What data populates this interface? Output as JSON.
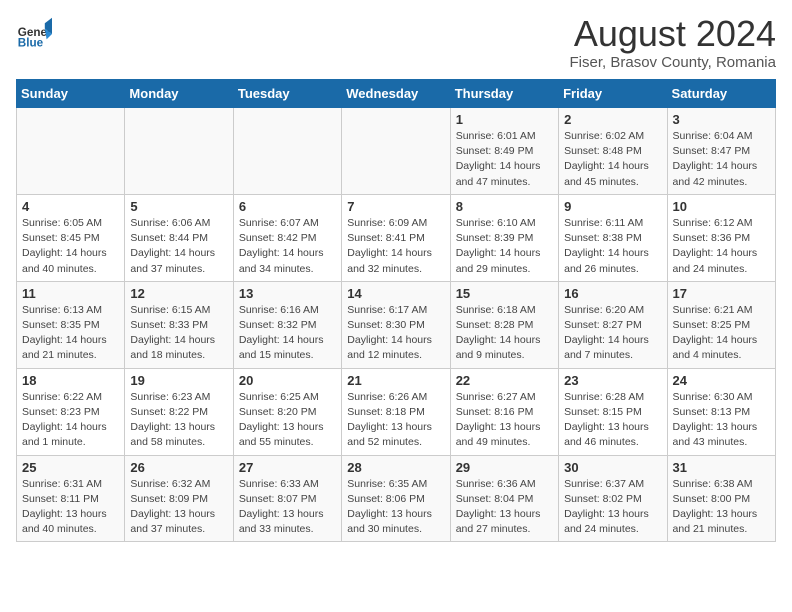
{
  "header": {
    "logo_general": "General",
    "logo_blue": "Blue",
    "month_year": "August 2024",
    "location": "Fiser, Brasov County, Romania"
  },
  "days_of_week": [
    "Sunday",
    "Monday",
    "Tuesday",
    "Wednesday",
    "Thursday",
    "Friday",
    "Saturday"
  ],
  "weeks": [
    [
      {
        "day": "",
        "info": ""
      },
      {
        "day": "",
        "info": ""
      },
      {
        "day": "",
        "info": ""
      },
      {
        "day": "",
        "info": ""
      },
      {
        "day": "1",
        "info": "Sunrise: 6:01 AM\nSunset: 8:49 PM\nDaylight: 14 hours and 47 minutes."
      },
      {
        "day": "2",
        "info": "Sunrise: 6:02 AM\nSunset: 8:48 PM\nDaylight: 14 hours and 45 minutes."
      },
      {
        "day": "3",
        "info": "Sunrise: 6:04 AM\nSunset: 8:47 PM\nDaylight: 14 hours and 42 minutes."
      }
    ],
    [
      {
        "day": "4",
        "info": "Sunrise: 6:05 AM\nSunset: 8:45 PM\nDaylight: 14 hours and 40 minutes."
      },
      {
        "day": "5",
        "info": "Sunrise: 6:06 AM\nSunset: 8:44 PM\nDaylight: 14 hours and 37 minutes."
      },
      {
        "day": "6",
        "info": "Sunrise: 6:07 AM\nSunset: 8:42 PM\nDaylight: 14 hours and 34 minutes."
      },
      {
        "day": "7",
        "info": "Sunrise: 6:09 AM\nSunset: 8:41 PM\nDaylight: 14 hours and 32 minutes."
      },
      {
        "day": "8",
        "info": "Sunrise: 6:10 AM\nSunset: 8:39 PM\nDaylight: 14 hours and 29 minutes."
      },
      {
        "day": "9",
        "info": "Sunrise: 6:11 AM\nSunset: 8:38 PM\nDaylight: 14 hours and 26 minutes."
      },
      {
        "day": "10",
        "info": "Sunrise: 6:12 AM\nSunset: 8:36 PM\nDaylight: 14 hours and 24 minutes."
      }
    ],
    [
      {
        "day": "11",
        "info": "Sunrise: 6:13 AM\nSunset: 8:35 PM\nDaylight: 14 hours and 21 minutes."
      },
      {
        "day": "12",
        "info": "Sunrise: 6:15 AM\nSunset: 8:33 PM\nDaylight: 14 hours and 18 minutes."
      },
      {
        "day": "13",
        "info": "Sunrise: 6:16 AM\nSunset: 8:32 PM\nDaylight: 14 hours and 15 minutes."
      },
      {
        "day": "14",
        "info": "Sunrise: 6:17 AM\nSunset: 8:30 PM\nDaylight: 14 hours and 12 minutes."
      },
      {
        "day": "15",
        "info": "Sunrise: 6:18 AM\nSunset: 8:28 PM\nDaylight: 14 hours and 9 minutes."
      },
      {
        "day": "16",
        "info": "Sunrise: 6:20 AM\nSunset: 8:27 PM\nDaylight: 14 hours and 7 minutes."
      },
      {
        "day": "17",
        "info": "Sunrise: 6:21 AM\nSunset: 8:25 PM\nDaylight: 14 hours and 4 minutes."
      }
    ],
    [
      {
        "day": "18",
        "info": "Sunrise: 6:22 AM\nSunset: 8:23 PM\nDaylight: 14 hours and 1 minute."
      },
      {
        "day": "19",
        "info": "Sunrise: 6:23 AM\nSunset: 8:22 PM\nDaylight: 13 hours and 58 minutes."
      },
      {
        "day": "20",
        "info": "Sunrise: 6:25 AM\nSunset: 8:20 PM\nDaylight: 13 hours and 55 minutes."
      },
      {
        "day": "21",
        "info": "Sunrise: 6:26 AM\nSunset: 8:18 PM\nDaylight: 13 hours and 52 minutes."
      },
      {
        "day": "22",
        "info": "Sunrise: 6:27 AM\nSunset: 8:16 PM\nDaylight: 13 hours and 49 minutes."
      },
      {
        "day": "23",
        "info": "Sunrise: 6:28 AM\nSunset: 8:15 PM\nDaylight: 13 hours and 46 minutes."
      },
      {
        "day": "24",
        "info": "Sunrise: 6:30 AM\nSunset: 8:13 PM\nDaylight: 13 hours and 43 minutes."
      }
    ],
    [
      {
        "day": "25",
        "info": "Sunrise: 6:31 AM\nSunset: 8:11 PM\nDaylight: 13 hours and 40 minutes."
      },
      {
        "day": "26",
        "info": "Sunrise: 6:32 AM\nSunset: 8:09 PM\nDaylight: 13 hours and 37 minutes."
      },
      {
        "day": "27",
        "info": "Sunrise: 6:33 AM\nSunset: 8:07 PM\nDaylight: 13 hours and 33 minutes."
      },
      {
        "day": "28",
        "info": "Sunrise: 6:35 AM\nSunset: 8:06 PM\nDaylight: 13 hours and 30 minutes."
      },
      {
        "day": "29",
        "info": "Sunrise: 6:36 AM\nSunset: 8:04 PM\nDaylight: 13 hours and 27 minutes."
      },
      {
        "day": "30",
        "info": "Sunrise: 6:37 AM\nSunset: 8:02 PM\nDaylight: 13 hours and 24 minutes."
      },
      {
        "day": "31",
        "info": "Sunrise: 6:38 AM\nSunset: 8:00 PM\nDaylight: 13 hours and 21 minutes."
      }
    ]
  ]
}
